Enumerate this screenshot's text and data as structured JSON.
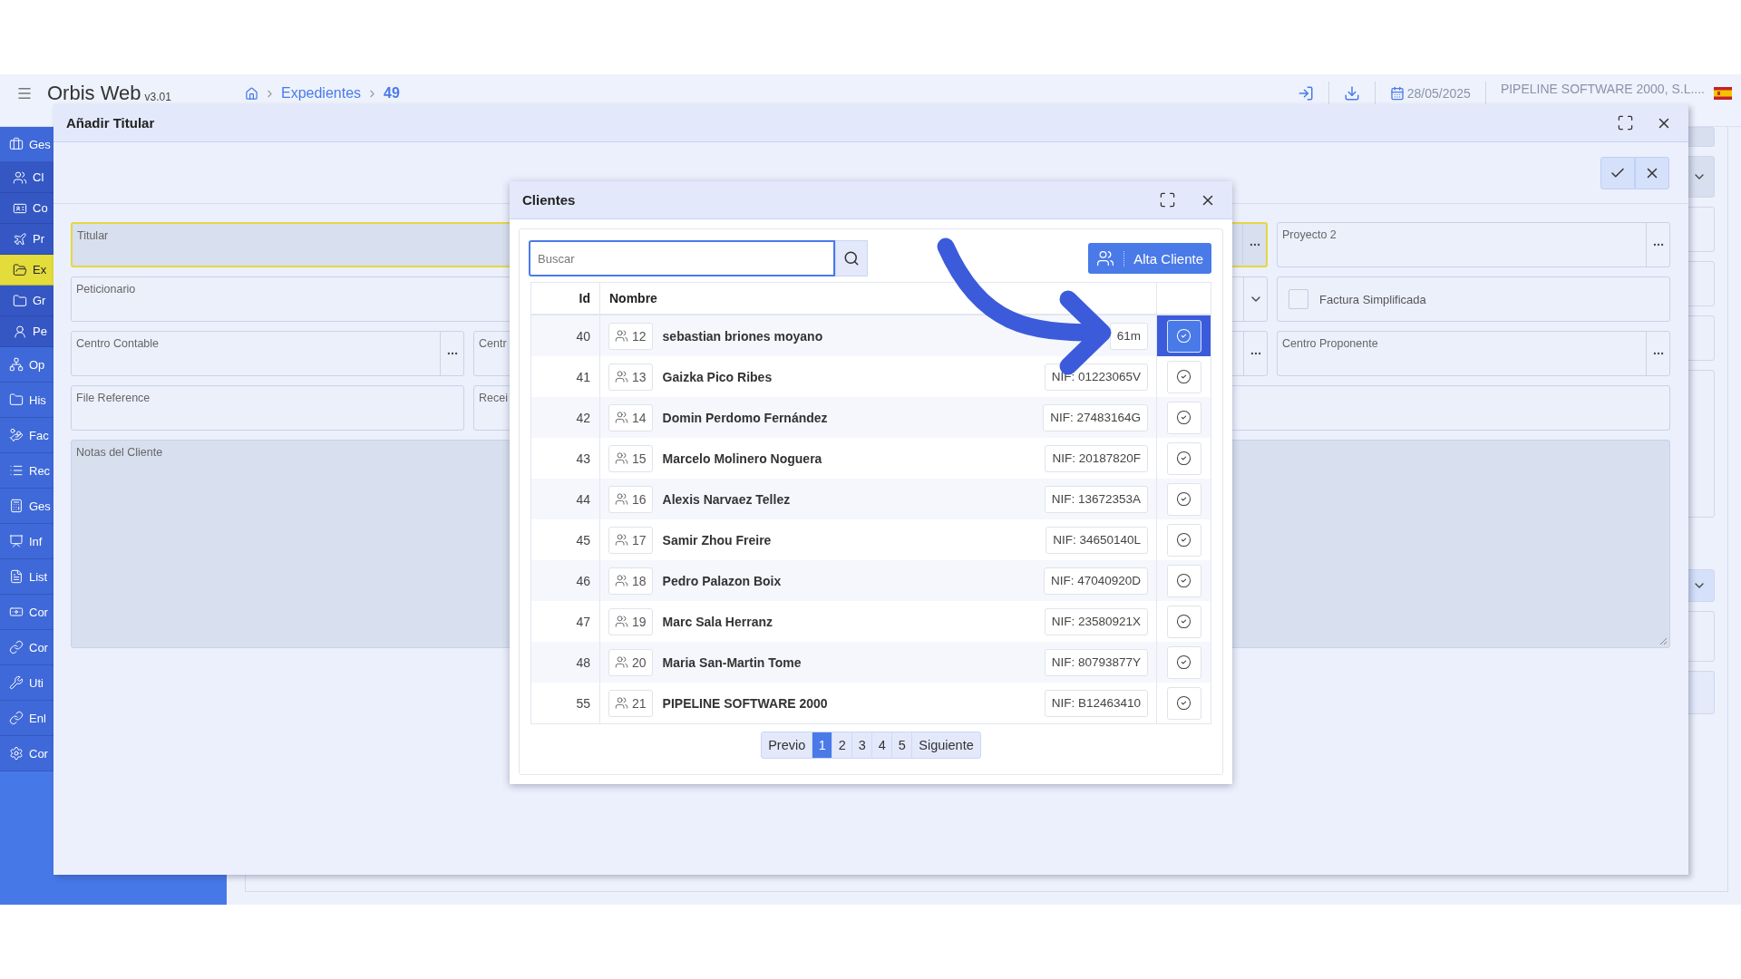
{
  "header": {
    "app_name": "Orbis Web",
    "version": "v3.01",
    "breadcrumb": [
      {
        "label": "Expedientes",
        "current": false
      },
      {
        "label": "49",
        "current": true
      }
    ],
    "date": "28/05/2025",
    "company": "PIPELINE SOFTWARE 2000, S.L...."
  },
  "sidebar": {
    "items": [
      {
        "label": "Ges",
        "selected": false,
        "expanded": true,
        "children": [
          {
            "label": "Cl",
            "selected": false
          },
          {
            "label": "Co",
            "selected": false
          },
          {
            "label": "Pr",
            "selected": false
          },
          {
            "label": "Ex",
            "selected": true
          },
          {
            "label": "Gr",
            "selected": false
          },
          {
            "label": "Pe",
            "selected": false
          }
        ]
      },
      {
        "label": "Op",
        "selected": false
      },
      {
        "label": "His",
        "selected": false
      },
      {
        "label": "Fac",
        "selected": false
      },
      {
        "label": "Rec",
        "selected": false
      },
      {
        "label": "Ges",
        "selected": false
      },
      {
        "label": "Inf",
        "selected": false
      },
      {
        "label": "List",
        "selected": false
      },
      {
        "label": "Cor",
        "selected": false
      },
      {
        "label": "Cor",
        "selected": false
      },
      {
        "label": "Uti",
        "selected": false
      },
      {
        "label": "Enl",
        "selected": false
      },
      {
        "label": "Cor",
        "selected": false
      }
    ]
  },
  "dialog": {
    "title": "Añadir Titular",
    "form_rows": [
      [
        {
          "label": "Titular",
          "kind": "lookup",
          "wide": true,
          "focused": true,
          "disabled": true
        },
        {
          "label": "Proyecto 2",
          "kind": "lookup",
          "wide": false,
          "focused": false,
          "disabled": false
        }
      ],
      [
        {
          "label": "Peticionario",
          "kind": "select",
          "wide": true,
          "focused": false,
          "disabled": false
        },
        {
          "label": "Factura Simplificada",
          "kind": "checkbox",
          "wide": false,
          "checked": false,
          "focused": false,
          "disabled": false
        }
      ],
      [
        {
          "label": "Centro Contable",
          "kind": "lookup",
          "wide": false,
          "focused": false,
          "disabled": false
        },
        {
          "label": "Centr",
          "kind": "lookup",
          "wide": false,
          "focused": false,
          "disabled": false
        },
        {
          "label": "Centro Proponente",
          "kind": "lookup",
          "wide": false,
          "focused": false,
          "disabled": false
        }
      ],
      [
        {
          "label": "File Reference",
          "kind": "text",
          "wide": false,
          "focused": false,
          "disabled": false
        },
        {
          "label": "Recei",
          "kind": "text",
          "wide": true,
          "focused": false,
          "disabled": false
        }
      ],
      [
        {
          "label": "Notas del Cliente",
          "kind": "textarea",
          "focused": false,
          "disabled": true
        }
      ]
    ]
  },
  "clients_dialog": {
    "title": "Clientes",
    "search": {
      "placeholder": "Buscar"
    },
    "add_button": "Alta Cliente",
    "columns": [
      "Id",
      "Nombre"
    ],
    "rows": [
      {
        "id": "40",
        "code": "12",
        "name": "sebastian briones moyano",
        "nif": "61m",
        "selected": true
      },
      {
        "id": "41",
        "code": "13",
        "name": "Gaizka Pico Ribes",
        "nif": "NIF: 01223065V",
        "selected": false
      },
      {
        "id": "42",
        "code": "14",
        "name": "Domin Perdomo Fernández",
        "nif": "NIF: 27483164G",
        "selected": false
      },
      {
        "id": "43",
        "code": "15",
        "name": "Marcelo Molinero Noguera",
        "nif": "NIF: 20187820F",
        "selected": false
      },
      {
        "id": "44",
        "code": "16",
        "name": "Alexis Narvaez Tellez",
        "nif": "NIF: 13672353A",
        "selected": false
      },
      {
        "id": "45",
        "code": "17",
        "name": "Samir Zhou Freire",
        "nif": "NIF: 34650140L",
        "selected": false
      },
      {
        "id": "46",
        "code": "18",
        "name": "Pedro Palazon Boix",
        "nif": "NIF: 47040920D",
        "selected": false
      },
      {
        "id": "47",
        "code": "19",
        "name": "Marc Sala Herranz",
        "nif": "NIF: 23580921X",
        "selected": false
      },
      {
        "id": "48",
        "code": "20",
        "name": "Maria San-Martin Tome",
        "nif": "NIF: 80793877Y",
        "selected": false
      },
      {
        "id": "55",
        "code": "21",
        "name": "PIPELINE SOFTWARE 2000",
        "nif": "NIF: B12463410",
        "selected": false
      }
    ],
    "pagination": {
      "previous": "Previo",
      "pages": [
        {
          "label": "1",
          "selected": true
        },
        {
          "label": "2",
          "selected": false
        },
        {
          "label": "3",
          "selected": false
        },
        {
          "label": "4",
          "selected": false
        },
        {
          "label": "5",
          "selected": false
        }
      ],
      "next": "Siguiente"
    }
  }
}
